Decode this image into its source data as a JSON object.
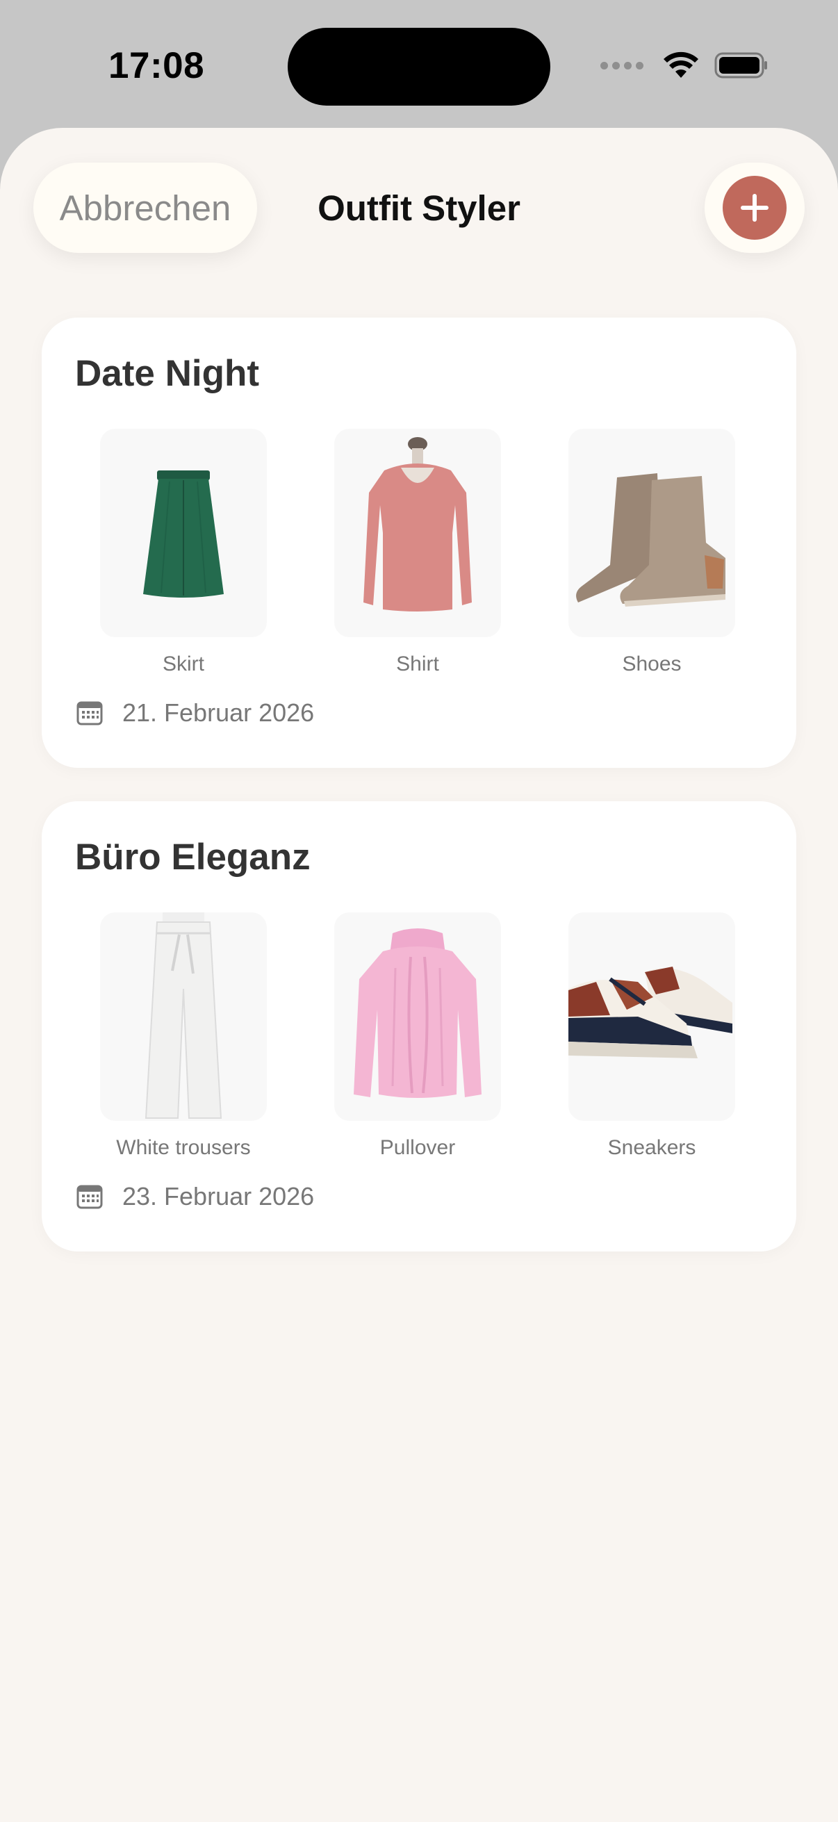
{
  "status_bar": {
    "time": "17:08"
  },
  "header": {
    "cancel_label": "Abbrechen",
    "title": "Outfit Styler"
  },
  "outfits": [
    {
      "title": "Date Night",
      "items": [
        {
          "label": "Skirt",
          "icon": "skirt-image"
        },
        {
          "label": "Shirt",
          "icon": "shirt-image"
        },
        {
          "label": "Shoes",
          "icon": "boots-image"
        }
      ],
      "date": "21. Februar 2026"
    },
    {
      "title": "Büro Eleganz",
      "items": [
        {
          "label": "White trousers",
          "icon": "trousers-image"
        },
        {
          "label": "Pullover",
          "icon": "pullover-image"
        },
        {
          "label": "Sneakers",
          "icon": "sneakers-image"
        }
      ],
      "date": "23. Februar 2026"
    }
  ],
  "colors": {
    "accent": "#c0695c",
    "sheet_bg": "#f9f5f1",
    "card_bg": "#ffffff"
  }
}
